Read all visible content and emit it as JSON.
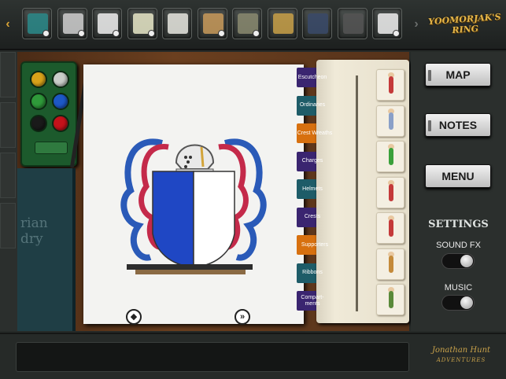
{
  "game": {
    "logo_text_1": "YOOMORJAK'S",
    "logo_text_2": "RING",
    "developer_logo_1": "Jonathan Hunt",
    "developer_logo_2": "ADVENTURES"
  },
  "inventory": {
    "left_arrow": "‹",
    "right_arrow": "›",
    "items": [
      {
        "icon": "card-icon",
        "selectable": true
      },
      {
        "icon": "phone-icon",
        "selectable": true
      },
      {
        "icon": "document-icon",
        "selectable": true
      },
      {
        "icon": "lighter-icon",
        "selectable": true
      },
      {
        "icon": "map-sheet-icon",
        "selectable": false
      },
      {
        "icon": "photo-icon",
        "selectable": true
      },
      {
        "icon": "banknote-icon",
        "selectable": true
      },
      {
        "icon": "binoculars-icon",
        "selectable": false
      },
      {
        "icon": "lantern-icon",
        "selectable": false
      },
      {
        "icon": "crowbar-icon",
        "selectable": false
      },
      {
        "icon": "notepad-icon",
        "selectable": true
      }
    ]
  },
  "palette": {
    "colors": [
      "#d9a21a",
      "#c9cdc9",
      "#2f9a3a",
      "#1d58c6",
      "#1a1a1a",
      "#c4121a"
    ]
  },
  "book": {
    "spine_text": "rian\ndry"
  },
  "help": {
    "label": "?"
  },
  "categories": [
    {
      "label": "Escutcheon",
      "color": "#3a2570"
    },
    {
      "label": "Ordinaries",
      "color": "#1e5c68"
    },
    {
      "label": "Crest Wreaths",
      "color": "#d7700f",
      "active": true
    },
    {
      "label": "Charges",
      "color": "#3a2570"
    },
    {
      "label": "Helmets",
      "color": "#1e5c68"
    },
    {
      "label": "Crests",
      "color": "#3a2570"
    },
    {
      "label": "Supporters",
      "color": "#d7700f",
      "active": true
    },
    {
      "label": "Ribbons",
      "color": "#1e5c68"
    },
    {
      "label": "Compart-ments",
      "color": "#3a2570"
    }
  ],
  "supporters": [
    "supporter-knight-icon",
    "supporter-monk-icon",
    "supporter-archer-icon",
    "supporter-soldier-icon",
    "supporter-jester-icon",
    "supporter-bishop-icon",
    "supporter-warrior-icon"
  ],
  "coat_of_arms": {
    "shield_left_color": "#1f47c4",
    "shield_right_color": "#ffffff",
    "mantling_color_1": "#c42a4a",
    "mantling_color_2": "#2a5ab8"
  },
  "page_nav": {
    "prev": "◆",
    "next": "»"
  },
  "menu": {
    "map": "MAP",
    "notes": "NOTES",
    "menu": "MENU"
  },
  "settings": {
    "title": "SETTINGS",
    "sound_fx_label": "SOUND FX",
    "sound_fx_on": true,
    "music_label": "MUSIC",
    "music_on": true
  },
  "message": ""
}
